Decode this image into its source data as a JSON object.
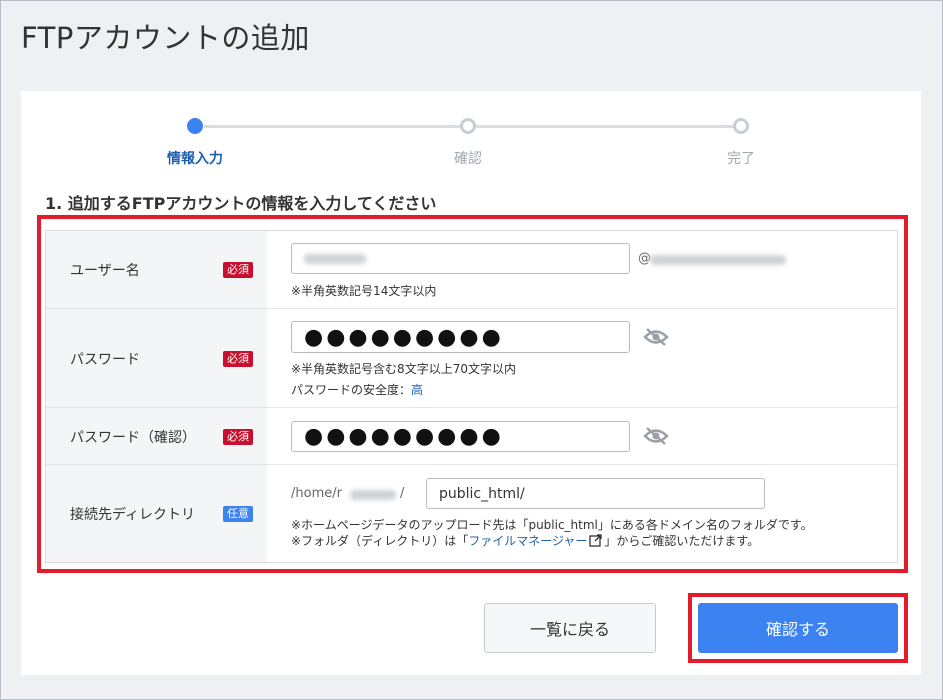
{
  "page": {
    "title": "FTPアカウントの追加"
  },
  "stepper": {
    "steps": [
      {
        "label": "情報入力",
        "state": "active"
      },
      {
        "label": "確認",
        "state": "inactive"
      },
      {
        "label": "完了",
        "state": "inactive"
      }
    ]
  },
  "form": {
    "heading": "1. 追加するFTPアカウントの情報を入力してください",
    "username": {
      "label": "ユーザー名",
      "badge": "必須",
      "at": "@",
      "note": "※半角英数記号14文字以内"
    },
    "password": {
      "label": "パスワード",
      "badge": "必須",
      "value": "●●●●●●●●●",
      "note1": "※半角英数記号含む8文字以上70文字以内",
      "strength_label": "パスワードの安全度：",
      "strength_value": "高",
      "icon": "eye-off-icon"
    },
    "password_confirm": {
      "label": "パスワード（確認）",
      "badge": "必須",
      "value": "●●●●●●●●●",
      "icon": "eye-off-icon"
    },
    "directory": {
      "label": "接続先ディレクトリ",
      "badge": "任意",
      "prefix_start": "/home/r",
      "prefix_end": "/",
      "value": "public_html/",
      "note1": "※ホームページデータのアップロード先は「public_html」にある各ドメイン名のフォルダです。",
      "note2_start": "※フォルダ（ディレクトリ）は「",
      "note2_link": "ファイルマネージャー",
      "note2_end": "」からご確認いただけます。"
    }
  },
  "actions": {
    "back_label": "一覧に戻る",
    "confirm_label": "確認する"
  },
  "colors": {
    "accent": "#3c82f0",
    "required_badge": "#c8102e",
    "highlight": "#e21c2a",
    "link": "#1f5fb0"
  }
}
